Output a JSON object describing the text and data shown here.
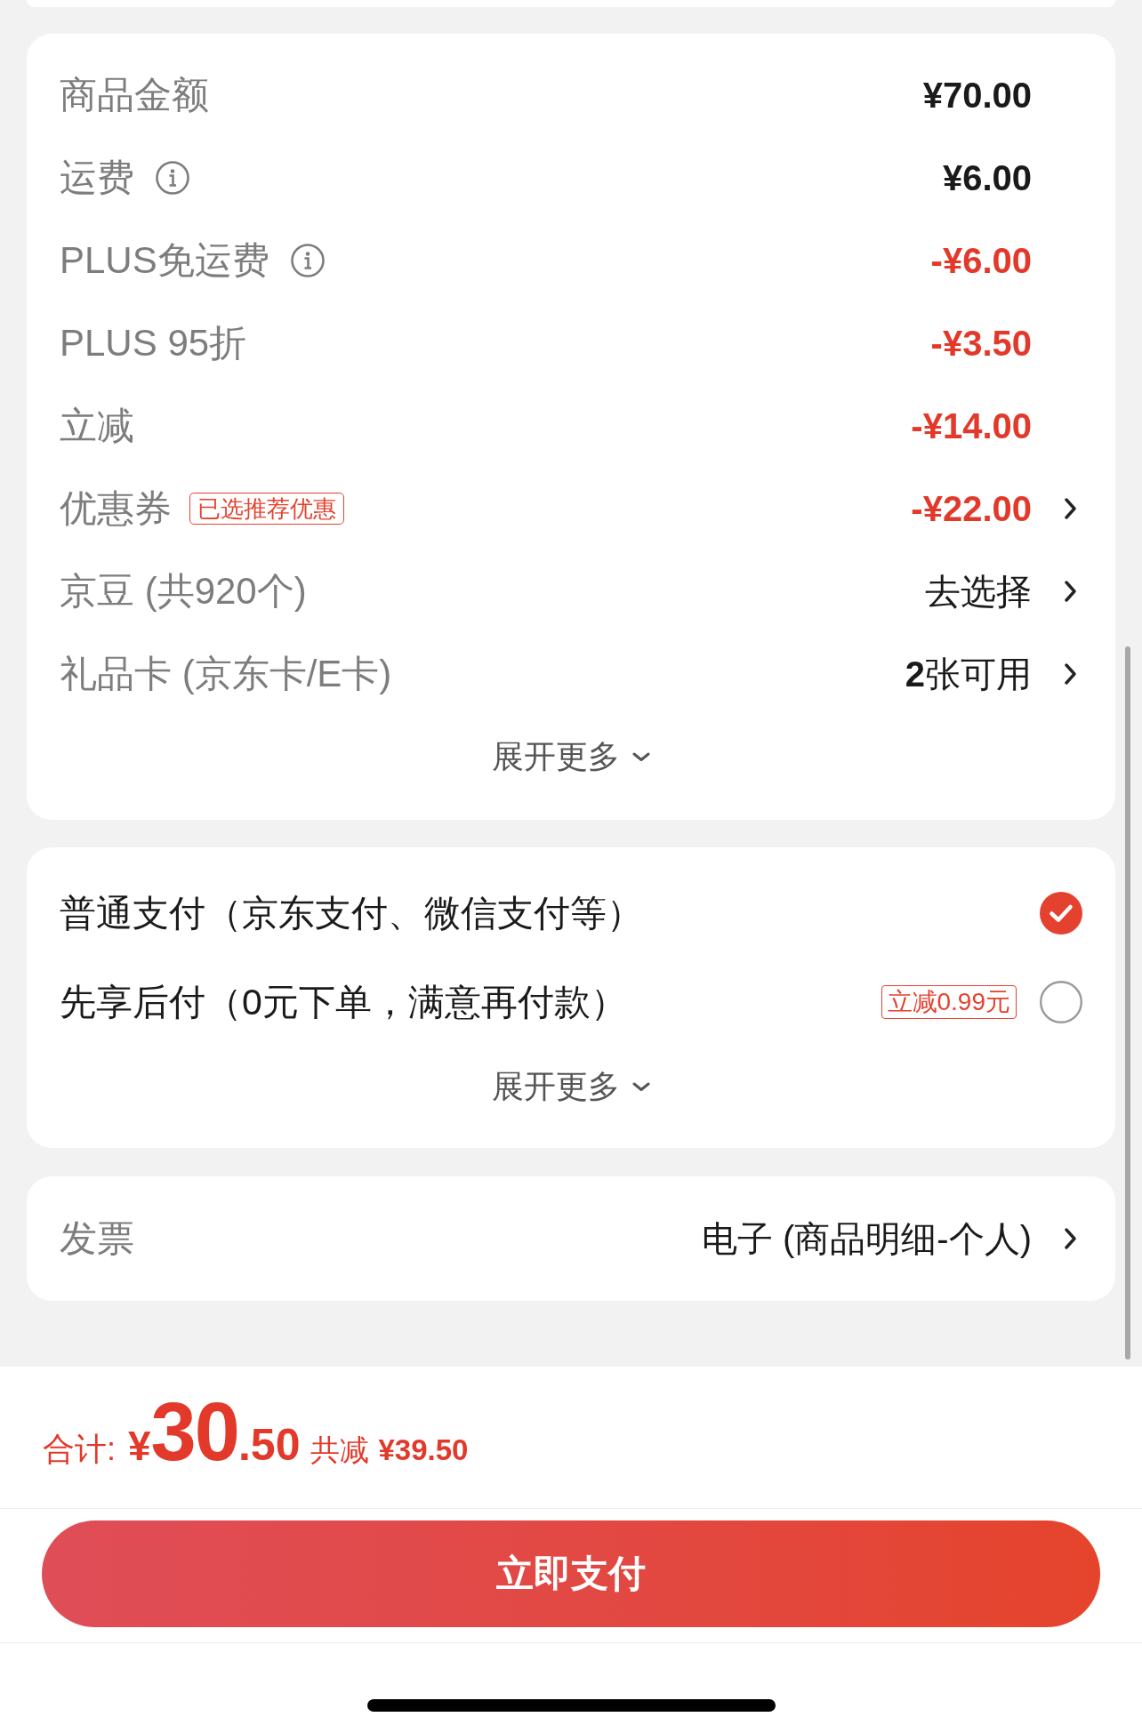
{
  "summary": {
    "rows": [
      {
        "label": "商品金额",
        "info": false,
        "value": "¥70.00",
        "value_bold": true,
        "discount": false,
        "chevron": false
      },
      {
        "label": "运费",
        "info": true,
        "value": "¥6.00",
        "value_bold": true,
        "discount": false,
        "chevron": false
      },
      {
        "label": "PLUS免运费",
        "info": true,
        "value": "-¥6.00",
        "value_bold": true,
        "discount": true,
        "chevron": false
      },
      {
        "label": "PLUS 95折",
        "info": false,
        "value": "-¥3.50",
        "value_bold": true,
        "discount": true,
        "chevron": false
      },
      {
        "label": "立减",
        "info": false,
        "value": "-¥14.00",
        "value_bold": true,
        "discount": true,
        "chevron": false
      },
      {
        "label": "优惠券",
        "info": false,
        "badge": "已选推荐优惠",
        "value": "-¥22.00",
        "value_bold": true,
        "discount": true,
        "chevron": true
      },
      {
        "label": "京豆 (共920个)",
        "info": false,
        "value": "去选择",
        "value_bold": false,
        "discount": false,
        "chevron": true
      },
      {
        "label": "礼品卡 (京东卡/E卡)",
        "info": false,
        "value": "**2**张可用",
        "value_bold": false,
        "discount": false,
        "chevron": true
      }
    ],
    "expand": "展开更多"
  },
  "payment": {
    "options": [
      {
        "label": "普通支付（京东支付、微信支付等）",
        "selected": true
      },
      {
        "label": "先享后付（0元下单，满意再付款）",
        "badge": "立减0.99元",
        "selected": false
      }
    ],
    "expand": "展开更多"
  },
  "invoice": {
    "label": "发票",
    "value": "电子 (商品明细-个人)",
    "chevron": true
  },
  "footer": {
    "total": {
      "label": "合计:",
      "currency": "¥",
      "whole": "30",
      "fraction": ".50"
    },
    "savings": {
      "label": "共减",
      "amount": "¥39.50"
    },
    "pay_button": "立即支付"
  }
}
